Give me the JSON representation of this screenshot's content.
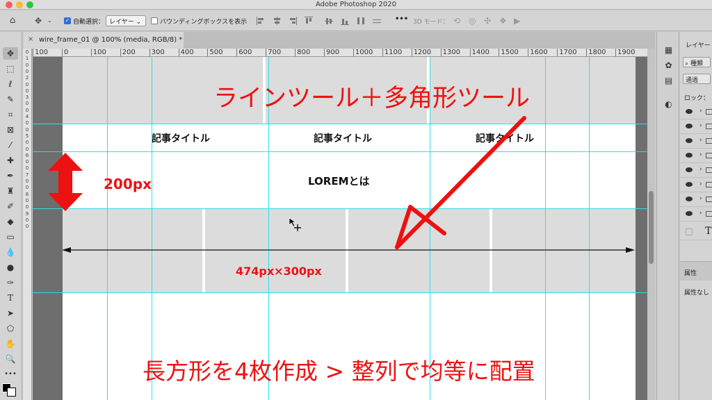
{
  "window": {
    "title": "Adobe Photoshop 2020",
    "traffic_colors": [
      "#ff5f57",
      "#febc2e",
      "#28c840"
    ]
  },
  "options_bar": {
    "auto_select_label": "自動選択：",
    "auto_select_value": "レイヤー",
    "show_bbox_label": "バウンディングボックスを表示",
    "mode_3d_label": "3D モード：",
    "more_glyph": "•••"
  },
  "doc_tab": {
    "close_glyph": "×",
    "title": "wire_frame_01 @ 100% (media, RGB/8) *"
  },
  "ruler": {
    "h_labels": [
      "100",
      "0",
      "100",
      "200",
      "300",
      "400",
      "500",
      "600",
      "700",
      "800",
      "900",
      "1000",
      "1100",
      "1200",
      "1300",
      "1400",
      "1500",
      "1600",
      "1700",
      "1800",
      "1900"
    ],
    "v_labels": [
      "0",
      "1",
      "0",
      "0",
      "2",
      "0",
      "0",
      "3",
      "0",
      "0",
      "4",
      "0",
      "0",
      "5",
      "0",
      "0",
      "6",
      "0",
      "0",
      "7",
      "0",
      "0",
      "8",
      "0",
      "0",
      "9",
      "0",
      "0"
    ]
  },
  "artboard": {
    "article_titles": [
      "記事タイトル",
      "記事タイトル",
      "記事タイトル"
    ],
    "lorem_heading": "LOREMとは"
  },
  "annotations": {
    "color": "#ee1111",
    "top_note": "ラインツール＋多角形ツール",
    "height_label": "200px",
    "size_label": "474px×300px",
    "bottom_note": "長方形を4枚作成 > 整列で均等に配置"
  },
  "guide_color": "#26e0e8",
  "layers_panel": {
    "tab_label": "レイヤー",
    "kind_label": "種類",
    "blend_mode": "通過",
    "lock_label": "ロック：",
    "text_layer_glyph": "T"
  },
  "properties_panel": {
    "tab_label": "属性",
    "empty_label": "属性なし"
  }
}
